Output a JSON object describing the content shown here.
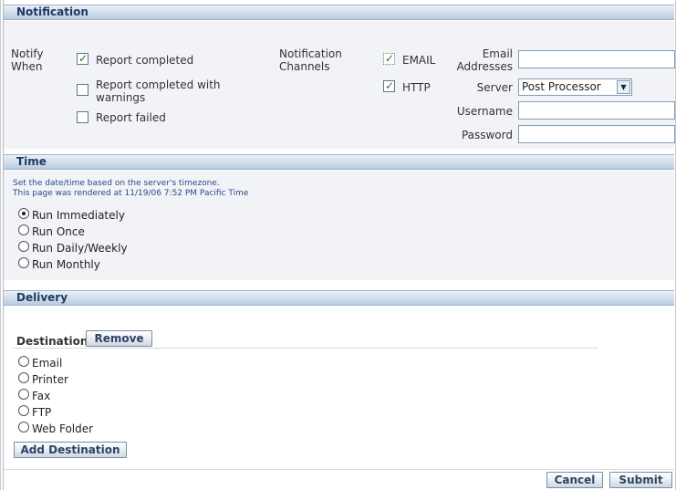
{
  "notification": {
    "header": "Notification",
    "notify_when_label": "Notify When",
    "options": [
      {
        "label": "Report completed",
        "checked": true
      },
      {
        "label": "Report completed with warnings",
        "checked": false
      },
      {
        "label": "Report failed",
        "checked": false
      }
    ],
    "channels_label": "Notification Channels",
    "channels": [
      {
        "label": "EMAIL",
        "checked": true
      },
      {
        "label": "HTTP",
        "checked": true
      }
    ],
    "email_addresses_label": "Email Addresses",
    "email_addresses_value": "",
    "server_label": "Server",
    "server_value": "Post Processor",
    "username_label": "Username",
    "username_value": "",
    "password_label": "Password",
    "password_value": ""
  },
  "time": {
    "header": "Time",
    "hint_line1": "Set the date/time based on the server's timezone.",
    "hint_line2": "This page was rendered at 11/19/06 7:52 PM Pacific Time",
    "options": [
      {
        "label": "Run Immediately",
        "selected": true
      },
      {
        "label": "Run Once",
        "selected": false
      },
      {
        "label": "Run Daily/Weekly",
        "selected": false
      },
      {
        "label": "Run Monthly",
        "selected": false
      }
    ]
  },
  "delivery": {
    "header": "Delivery",
    "destination_label": "Destination",
    "remove_button": "Remove",
    "options": [
      {
        "label": "Email",
        "selected": false
      },
      {
        "label": "Printer",
        "selected": false
      },
      {
        "label": "Fax",
        "selected": false
      },
      {
        "label": "FTP",
        "selected": false
      },
      {
        "label": "Web Folder",
        "selected": false
      }
    ],
    "add_destination_button": "Add Destination"
  },
  "footer": {
    "cancel_button": "Cancel",
    "submit_button": "Submit"
  }
}
